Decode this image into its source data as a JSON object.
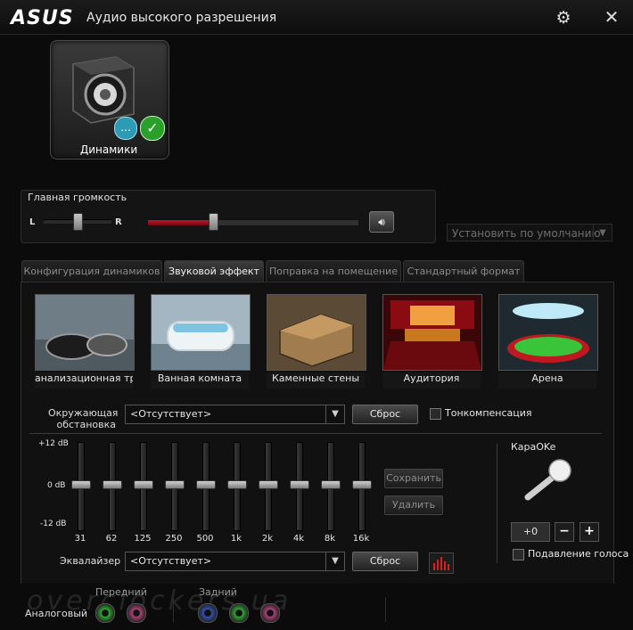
{
  "window": {
    "logo": "/ISUS",
    "title": "Аудио высокого разрешения"
  },
  "device": {
    "label": "Динамики"
  },
  "volume": {
    "title": "Главная громкость",
    "left": "L",
    "right": "R",
    "level": 0.31,
    "balance": 0.5
  },
  "default_dropdown": {
    "label": "Установить по умолчанию"
  },
  "tabs": [
    {
      "label": "Конфигурация динамиков"
    },
    {
      "label": "Звуковой эффект"
    },
    {
      "label": "Поправка на помещение"
    },
    {
      "label": "Стандартный формат"
    }
  ],
  "effects": [
    {
      "label": "анализационная труб"
    },
    {
      "label": "Ванная комната"
    },
    {
      "label": "Каменные стены"
    },
    {
      "label": "Аудитория"
    },
    {
      "label": "Арена"
    }
  ],
  "environment": {
    "label": "Окружающая обстановка",
    "value": "<Отсутствует>",
    "reset": "Сброс",
    "loudness": "Тонкомпенсация"
  },
  "equalizer": {
    "db_top": "+12 dB",
    "db_mid": "0 dB",
    "db_bottom": "-12 dB",
    "bands": [
      "31",
      "62",
      "125",
      "250",
      "500",
      "1k",
      "2k",
      "4k",
      "8k",
      "16k"
    ],
    "save": "Сохранить",
    "delete": "Удалить",
    "label": "Эквалайзер",
    "preset": "<Отсутствует>",
    "reset": "Сброс"
  },
  "karaoke": {
    "title": "КараOKe",
    "value": "+0",
    "minus": "−",
    "plus": "+",
    "voice_cancel": "Подавление голоса"
  },
  "bottom": {
    "analog": "Аналоговый",
    "front": "Передний",
    "rear": "Задний",
    "watermark": "overclockers.ua"
  },
  "colors": {
    "accent": "#c0182a",
    "jack_green": "#2faa2f",
    "jack_pink": "#b0407a",
    "jack_blue": "#3050b0"
  }
}
